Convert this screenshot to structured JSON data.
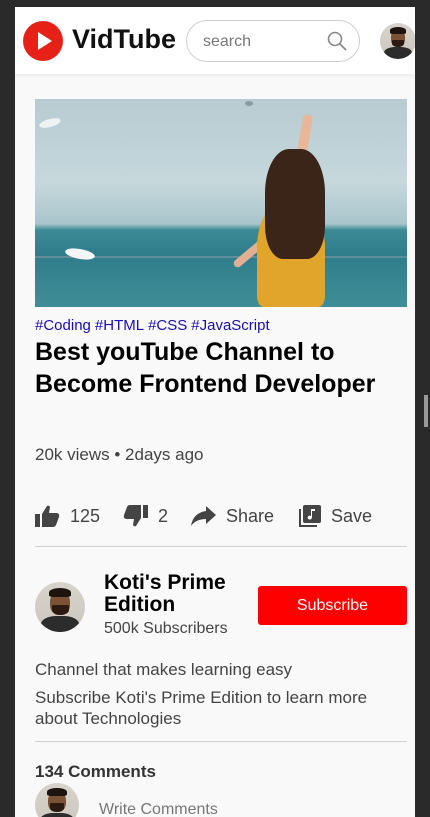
{
  "header": {
    "logo_text": "VidTube",
    "search_placeholder": "search",
    "icons": {
      "logo": "play-logo-icon",
      "search": "search-icon",
      "avatar": "user-avatar"
    }
  },
  "video": {
    "tags": [
      "#Coding",
      "#HTML",
      "#CSS",
      "#JavaScript"
    ],
    "title": "Best youTube Channel to Become Frontend Developer",
    "meta": "20k views • 2days ago",
    "actions": {
      "like_count": "125",
      "dislike_count": "2",
      "share_label": "Share",
      "save_label": "Save"
    }
  },
  "channel": {
    "name": "Koti's Prime Edition",
    "subscribers": "500k Subscribers",
    "subscribe_label": "Subscribe",
    "description_1": "Channel that makes learning easy",
    "description_2": "Subscribe Koti's Prime Edition to learn more about Technologies"
  },
  "comments": {
    "count_label": "134 Comments",
    "input_placeholder": "Write Comments"
  },
  "colors": {
    "brand_red": "#ff0000",
    "tag_blue": "#1a0dab",
    "background": "#f9f9f9"
  }
}
